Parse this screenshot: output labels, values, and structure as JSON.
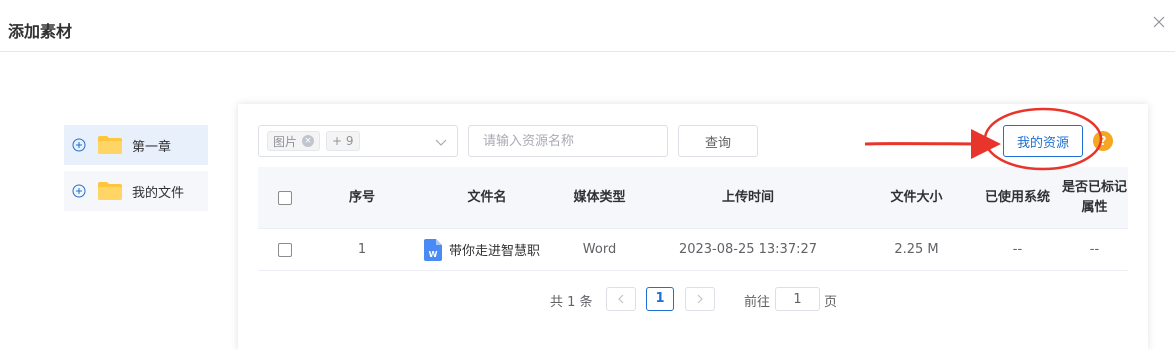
{
  "dialog": {
    "title": "添加素材"
  },
  "tree": {
    "items": [
      {
        "label": "第一章",
        "active": true
      },
      {
        "label": "我的文件",
        "active": false
      }
    ]
  },
  "toolbar": {
    "type_tag": "图片",
    "more_tag": "+ 9",
    "search_placeholder": "请输入资源名称",
    "query_label": "查询",
    "my_resource_label": "我的资源",
    "help_label": "?"
  },
  "table": {
    "headers": {
      "index": "序号",
      "file_name": "文件名",
      "media_type": "媒体类型",
      "upload_time": "上传时间",
      "file_size": "文件大小",
      "used_system": "已使用系统",
      "marked_attr_line1": "是否已标记",
      "marked_attr_line2": "属性"
    },
    "rows": [
      {
        "index": "1",
        "file_name": "带你走进智慧职",
        "media_type": "Word",
        "upload_time": "2023-08-25 13:37:27",
        "file_size": "2.25 M",
        "used_system": "--",
        "marked_attr": "--"
      }
    ]
  },
  "pagination": {
    "total": "共 1 条",
    "current_page": "1",
    "goto_label": "前往",
    "goto_value": "1",
    "page_label": "页"
  },
  "colors": {
    "accent": "#1f6fd4",
    "folder": "#ffc53d",
    "annotation": "#e8352b",
    "help": "#f5a623"
  }
}
